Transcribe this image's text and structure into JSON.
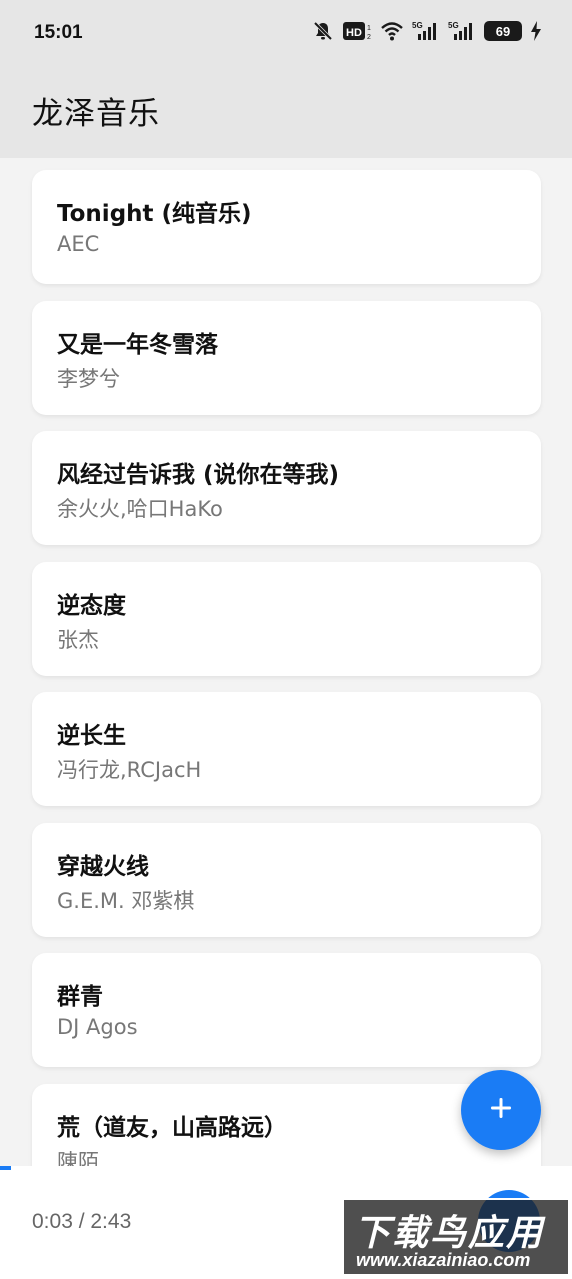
{
  "status_bar": {
    "time": "15:01",
    "battery": "69",
    "icons": [
      "bell-off-icon",
      "hd-icon",
      "wifi-icon",
      "5g-signal-icon",
      "5g-signal-icon",
      "battery-icon",
      "charging-icon"
    ]
  },
  "app": {
    "title": "龙泽音乐"
  },
  "songs": [
    {
      "title": "Tonight (纯音乐)",
      "artist": "AEC"
    },
    {
      "title": "又是一年冬雪落",
      "artist": "李梦兮"
    },
    {
      "title": "风经过告诉我 (说你在等我)",
      "artist": "余火火,哈口HaKo"
    },
    {
      "title": "逆态度",
      "artist": "张杰"
    },
    {
      "title": "逆长生",
      "artist": "冯行龙,RCJacH"
    },
    {
      "title": "穿越火线",
      "artist": "G.E.M. 邓紫棋"
    },
    {
      "title": "群青",
      "artist": "DJ Agos"
    },
    {
      "title": "荒（道友，山高路远）",
      "artist": "陳陌"
    }
  ],
  "fab": {
    "icon": "plus-icon"
  },
  "player": {
    "time": "0:03 / 2:43",
    "progress": 0.02
  },
  "watermark": {
    "main": "下载鸟应用",
    "sub": "www.xiazainiao.com"
  },
  "colors": {
    "accent": "#1a7cf5",
    "header_bg": "#e6e6e6",
    "page_bg": "#f3f3f3",
    "card_bg": "#ffffff"
  }
}
